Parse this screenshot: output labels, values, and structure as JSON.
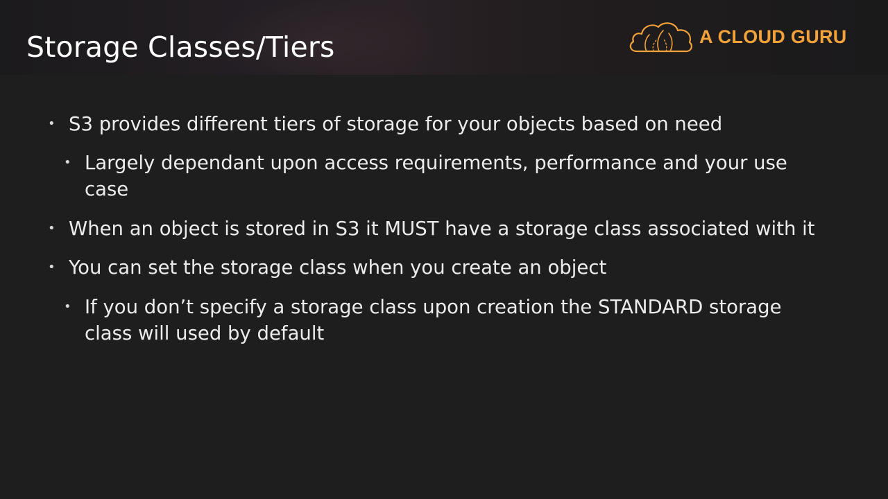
{
  "slide": {
    "title": "Storage Classes/Tiers",
    "logo": {
      "text": "A CLOUD GURU",
      "icon": "cloud-icon",
      "brand_color": "#f3a23a"
    },
    "bullets": [
      {
        "level": 1,
        "lines": [
          "S3 provides different tiers of storage for your objects based on need"
        ]
      },
      {
        "level": 2,
        "lines": [
          "Largely dependant upon access requirements, performance and your use",
          "case"
        ]
      },
      {
        "level": 1,
        "lines": [
          "When an object is stored in S3 it MUST have a storage class associated with it"
        ]
      },
      {
        "level": 1,
        "lines": [
          "You can set the storage class when you create an object"
        ]
      },
      {
        "level": 2,
        "lines": [
          "If you don’t specify a storage class upon creation the STANDARD storage",
          "class will used by default"
        ]
      }
    ],
    "bullet_glyph": "•"
  }
}
